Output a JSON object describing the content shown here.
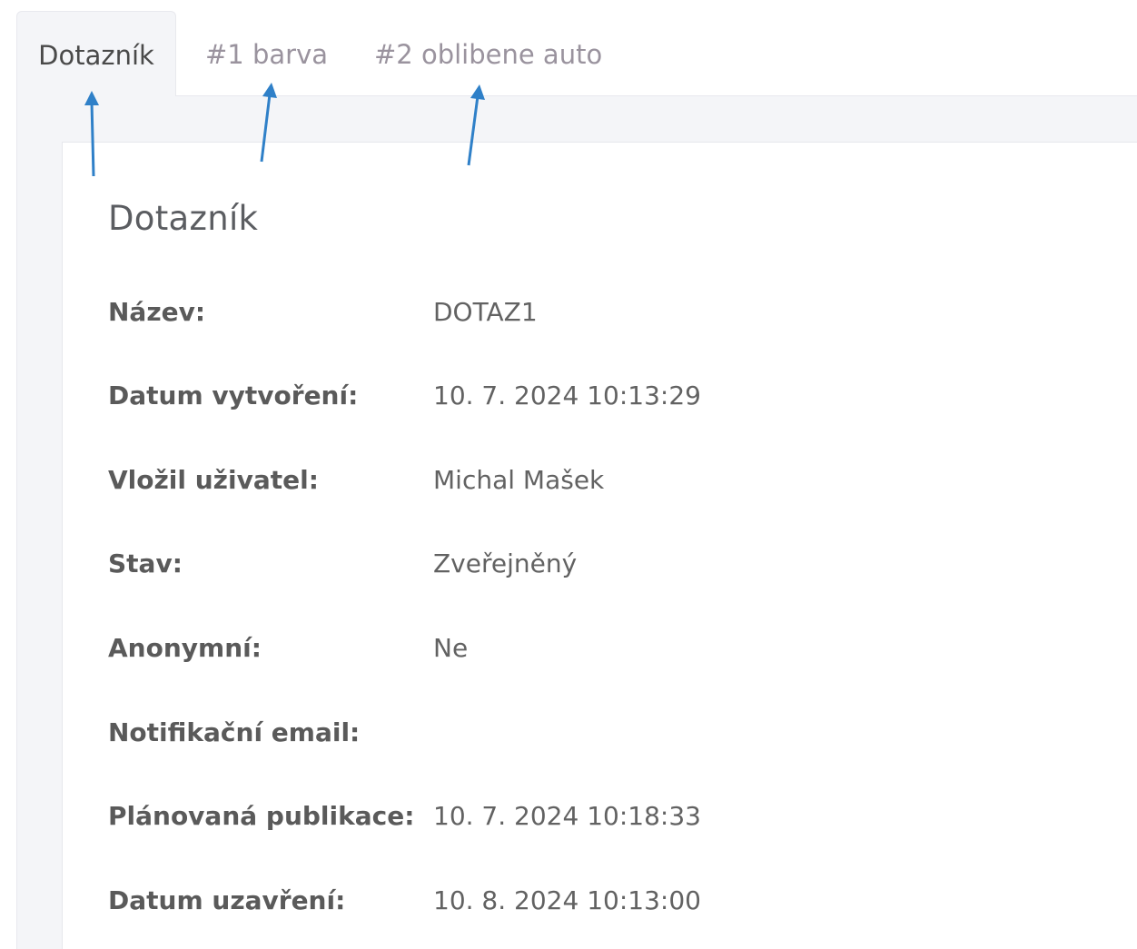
{
  "tabs": [
    {
      "label": "Dotazník",
      "active": true
    },
    {
      "label": "#1 barva",
      "active": false
    },
    {
      "label": "#2 oblibene auto",
      "active": false
    }
  ],
  "card": {
    "title": "Dotazník",
    "fields": [
      {
        "label": "Název:",
        "value": "DOTAZ1"
      },
      {
        "label": "Datum vytvoření:",
        "value": "10. 7. 2024 10:13:29"
      },
      {
        "label": "Vložil uživatel:",
        "value": "Michal Mašek"
      },
      {
        "label": "Stav:",
        "value": "Zveřejněný"
      },
      {
        "label": "Anonymní:",
        "value": "Ne"
      },
      {
        "label": "Notifikační email:",
        "value": ""
      },
      {
        "label": "Plánovaná publikace:",
        "value": "10. 7. 2024 10:18:33"
      },
      {
        "label": "Datum uzavření:",
        "value": "10. 8. 2024 10:13:00"
      }
    ]
  },
  "colors": {
    "arrow": "#2f80c8",
    "panel_bg": "#f4f5f8",
    "inactive_tab_text": "#9a939e"
  }
}
